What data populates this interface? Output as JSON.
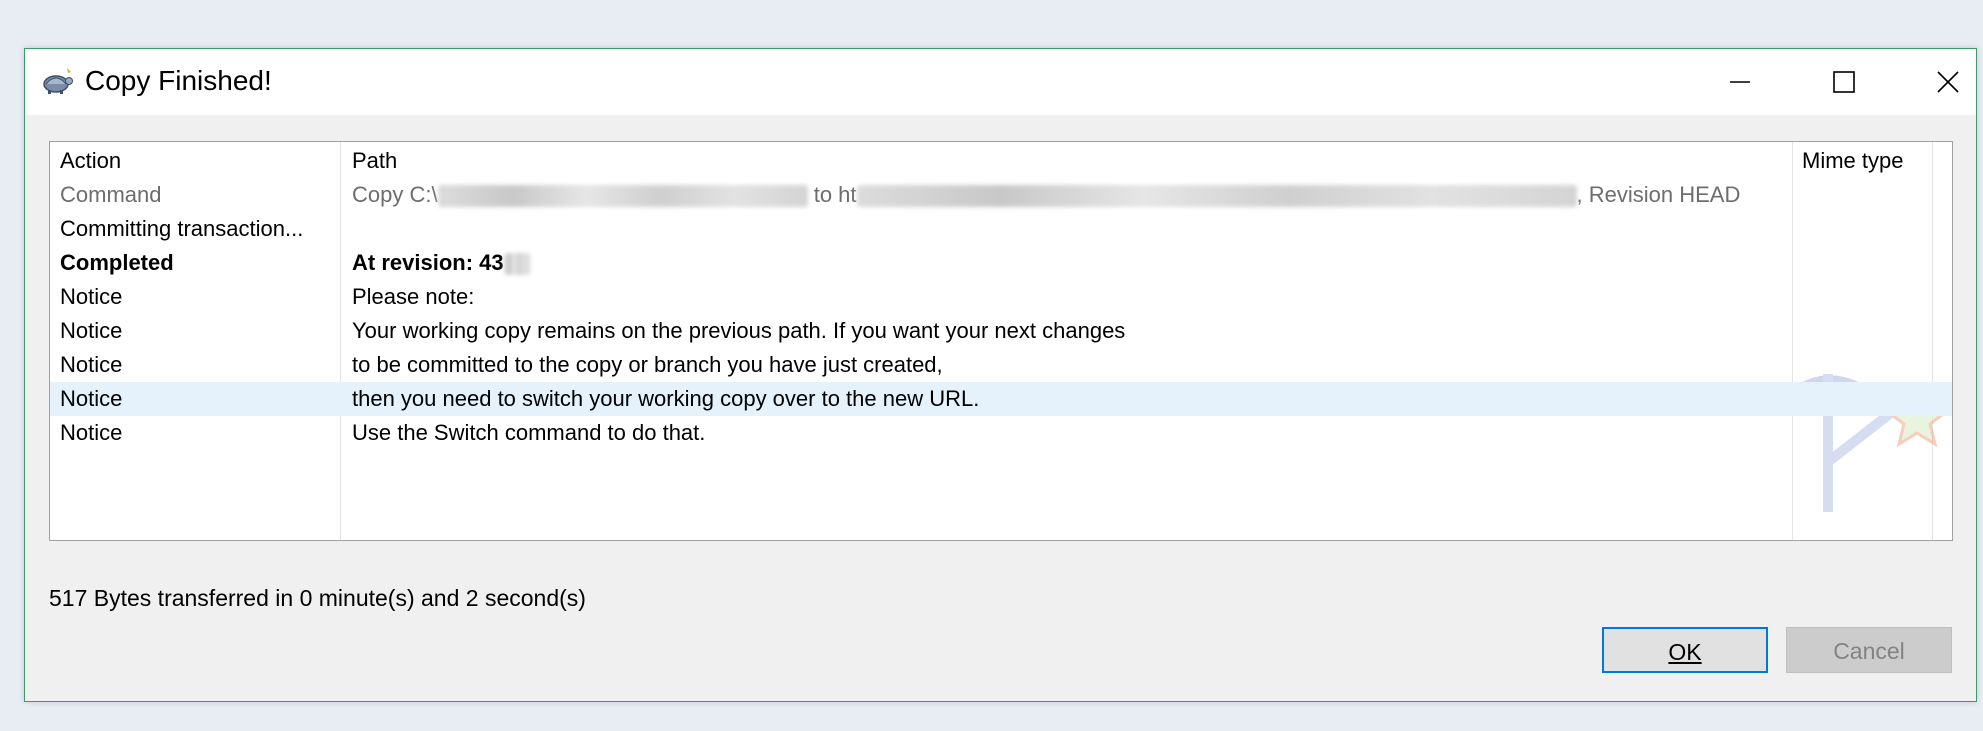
{
  "window": {
    "title": "Copy Finished!"
  },
  "columns": {
    "action": "Action",
    "path": "Path",
    "mime": "Mime type"
  },
  "rows": [
    {
      "action": "Command",
      "path_prefix": "Copy C:\\",
      "path_mid": "to ht",
      "path_suffix": ", Revision HEAD"
    },
    {
      "action": "Committing transaction...",
      "path": ""
    },
    {
      "action": "Completed",
      "path": "At revision: 43"
    },
    {
      "action": "Notice",
      "path": "Please note:"
    },
    {
      "action": "Notice",
      "path": "Your working copy remains on the previous path. If you want your next changes"
    },
    {
      "action": "Notice",
      "path": "to be committed to the copy or branch you have just created,"
    },
    {
      "action": "Notice",
      "path": "then you need to switch your working copy over to the new URL."
    },
    {
      "action": "Notice",
      "path": "Use the Switch command to do that."
    }
  ],
  "status_text": "517 Bytes transferred in 0 minute(s) and 2 second(s)",
  "buttons": {
    "ok": "OK",
    "cancel": "Cancel"
  },
  "icons": {
    "app": "tortoisesvn-icon",
    "watermark": "tortoisesvn-watermark"
  },
  "colors": {
    "selection": "#e5f1fb",
    "ok_border": "#0078d7",
    "window_border": "#3c9a6a"
  }
}
